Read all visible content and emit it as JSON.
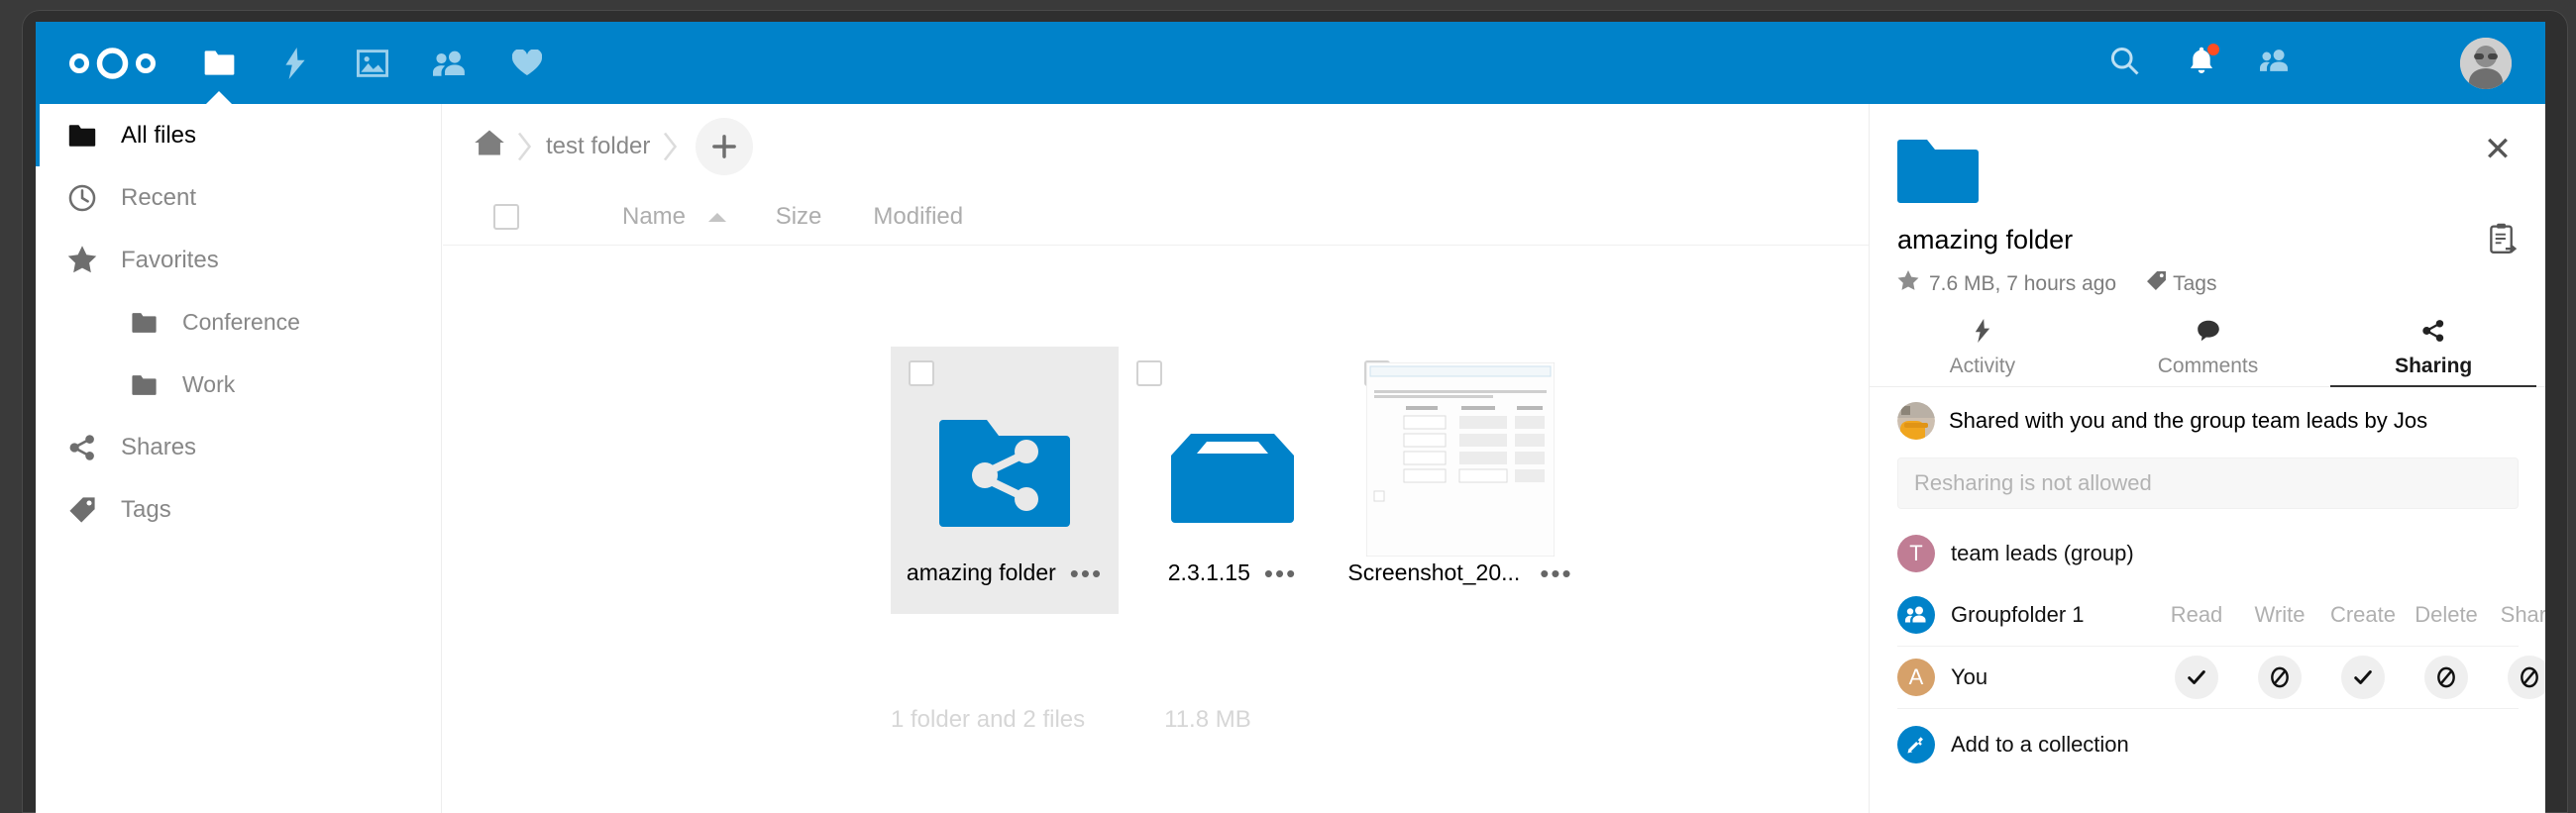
{
  "app": {
    "brand_color": "#0082c9",
    "logo_name": "nextcloud-logo"
  },
  "header": {
    "apps": [
      {
        "name": "files-app",
        "icon": "folder-icon",
        "label": "Files",
        "active": true
      },
      {
        "name": "activity-app",
        "icon": "lightning-icon",
        "label": "Activity",
        "active": false
      },
      {
        "name": "photos-app",
        "icon": "picture-icon",
        "label": "Photos",
        "active": false
      },
      {
        "name": "contacts-app",
        "icon": "contacts-icon",
        "label": "Contacts",
        "active": false
      },
      {
        "name": "favorites-app",
        "icon": "heart-icon",
        "label": "Favorites",
        "active": false
      }
    ],
    "right": [
      {
        "name": "search-icon",
        "label": "Search"
      },
      {
        "name": "notifications-bell-icon",
        "label": "Notifications",
        "badge": true
      },
      {
        "name": "contacts-menu-icon",
        "label": "Contacts"
      }
    ],
    "avatar": {
      "name": "user-avatar",
      "label": "User"
    }
  },
  "sidebar": {
    "items": [
      {
        "label": "All files",
        "icon": "folder-icon",
        "active": true,
        "sub": false
      },
      {
        "label": "Recent",
        "icon": "clock-icon",
        "active": false,
        "sub": false
      },
      {
        "label": "Favorites",
        "icon": "star-icon",
        "active": false,
        "sub": false
      },
      {
        "label": "Conference",
        "icon": "folder-icon",
        "active": false,
        "sub": true
      },
      {
        "label": "Work",
        "icon": "folder-icon",
        "active": false,
        "sub": true
      },
      {
        "label": "Shares",
        "icon": "share-icon",
        "active": false,
        "sub": false
      },
      {
        "label": "Tags",
        "icon": "tag-icon",
        "active": false,
        "sub": false
      }
    ]
  },
  "breadcrumb": {
    "home_icon": "home-icon",
    "crumbs": [
      "test folder"
    ],
    "new_button_label": "+"
  },
  "filelist": {
    "columns": {
      "name": "Name",
      "size": "Size",
      "modified": "Modified",
      "sort_direction": "ascending"
    },
    "files": [
      {
        "name": "amazing folder",
        "type": "shared-folder",
        "selected": true,
        "thumb": "shared-folder-icon"
      },
      {
        "name": "2.3.1.15",
        "type": "archive",
        "selected": false,
        "thumb": "package-icon"
      },
      {
        "name": "Screenshot_20...",
        "type": "image",
        "selected": false,
        "thumb": "screenshot-preview"
      }
    ],
    "summary": {
      "count": "1 folder and 2 files",
      "size": "11.8 MB"
    }
  },
  "detail": {
    "close_label": "✕",
    "icon": "folder-icon",
    "title": "amazing folder",
    "actions_icon": "clipboard-move-icon",
    "favorite_icon": "star-icon",
    "meta": "7.6 MB, 7 hours ago",
    "tags_label": "Tags",
    "tags_icon": "tag-icon",
    "tabs": [
      {
        "label": "Activity",
        "icon": "lightning-icon",
        "active": false
      },
      {
        "label": "Comments",
        "icon": "comment-icon",
        "active": false
      },
      {
        "label": "Sharing",
        "icon": "share-icon",
        "active": true
      }
    ],
    "sharing": {
      "shared_by_text": "Shared with you and the group team leads by Jos",
      "shared_by_avatar": "photo-avatar",
      "reshare_placeholder": "Resharing is not allowed",
      "rows": [
        {
          "name": "team leads (group)",
          "avatar_letter": "T",
          "avatar_color": "#c07d94",
          "avatar_type": "letter",
          "show_perms": false
        },
        {
          "name": "Groupfolder 1",
          "avatar_letter": "",
          "avatar_color": "#0082c9",
          "avatar_type": "group-icon",
          "show_perms": true,
          "perm_headers": [
            "Read",
            "Write",
            "Create",
            "Delete",
            "Share"
          ]
        },
        {
          "name": "You",
          "avatar_letter": "A",
          "avatar_color": "#d6a16a",
          "avatar_type": "letter",
          "show_perms": false,
          "perm_values": [
            "allowed",
            "denied",
            "allowed",
            "denied",
            "denied"
          ]
        }
      ],
      "collection": {
        "label": "Add to a collection",
        "icon": "plug-icon",
        "icon_color": "#0082c9"
      }
    }
  }
}
